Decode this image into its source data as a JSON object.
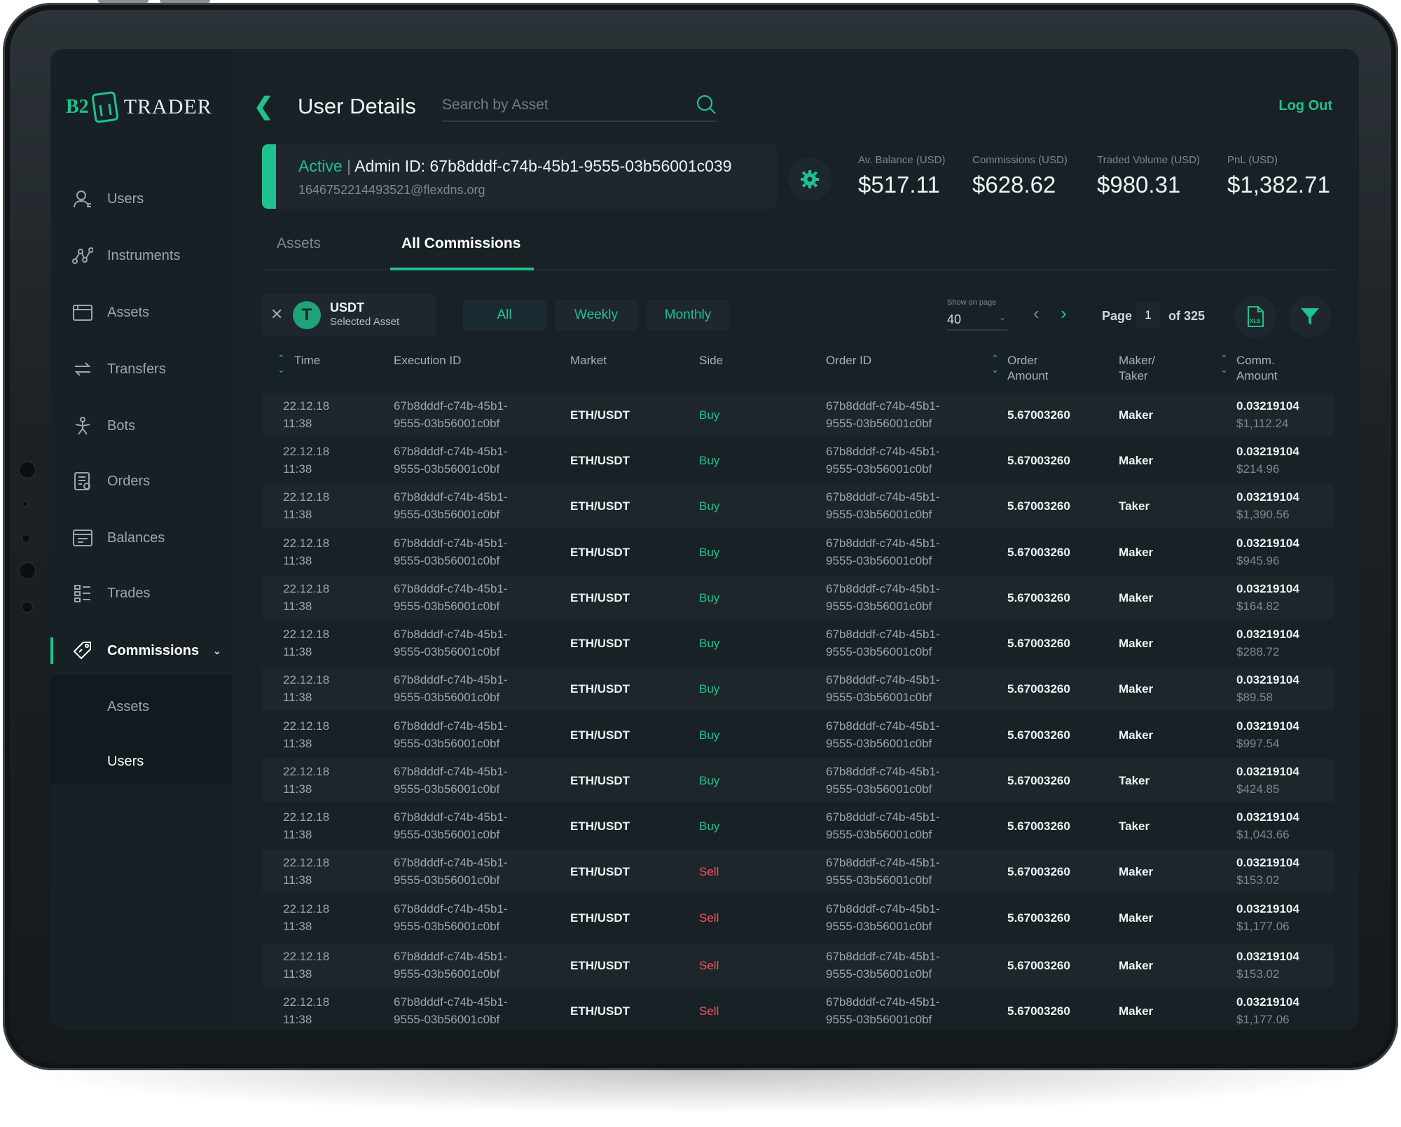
{
  "brand": {
    "left": "B2",
    "right": "TRADER"
  },
  "colors": {
    "accent": "#1fc28e",
    "sell": "#f0555c",
    "background": "#182126",
    "sidebar": "#162025"
  },
  "sidebar": {
    "items": [
      {
        "label": "Users",
        "icon": "user-icon"
      },
      {
        "label": "Instruments",
        "icon": "instruments-icon"
      },
      {
        "label": "Assets",
        "icon": "wallet-icon"
      },
      {
        "label": "Transfers",
        "icon": "transfer-icon"
      },
      {
        "label": "Bots",
        "icon": "bot-icon"
      },
      {
        "label": "Orders",
        "icon": "orders-icon"
      },
      {
        "label": "Balances",
        "icon": "balances-icon"
      },
      {
        "label": "Trades",
        "icon": "trades-icon"
      },
      {
        "label": "Commissions",
        "icon": "tag-icon",
        "active": true
      }
    ],
    "submenu": [
      {
        "label": "Assets"
      },
      {
        "label": "Users",
        "active": true
      }
    ]
  },
  "header": {
    "title": "User Details",
    "search_placeholder": "Search by Asset",
    "logout": "Log Out"
  },
  "admin": {
    "status": "Active",
    "separator": "|",
    "id_text": "Admin ID: 67b8dddf-c74b-45b1-9555-03b56001c039",
    "email": "1646752214493521@flexdns.org"
  },
  "stats": [
    {
      "label": "Av. Balance (USD)",
      "value": "$517.11"
    },
    {
      "label": "Commissions (USD)",
      "value": "$628.62"
    },
    {
      "label": "Traded Volume (USD)",
      "value": "$980.31"
    },
    {
      "label": "PnL (USD)",
      "value": "$1,382.71"
    }
  ],
  "tabs": [
    {
      "label": "Assets"
    },
    {
      "label": "All Commissions",
      "active": true
    }
  ],
  "filters": {
    "asset_name": "USDT",
    "asset_sub": "Selected Asset",
    "asset_symbol": "T",
    "periods": [
      "All",
      "Weekly",
      "Monthly"
    ],
    "active_period": "All"
  },
  "pagination": {
    "show_label": "Show on page",
    "per_page": "40",
    "page_word": "Page",
    "page": "1",
    "of_text": "of 325"
  },
  "table": {
    "headers": {
      "time": "Time",
      "execution_id": "Execution ID",
      "market": "Market",
      "side": "Side",
      "order_id": "Order ID",
      "order_amount_1": "Order",
      "order_amount_2": "Amount",
      "maker_taker_1": "Maker/",
      "maker_taker_2": "Taker",
      "comm_amount_1": "Comm.",
      "comm_amount_2": "Amount"
    },
    "rows": [
      {
        "date": "22.12.18",
        "time": "11:38",
        "exec1": "67b8dddf-c74b-45b1-",
        "exec2": "9555-03b56001c0bf",
        "market": "ETH/USDT",
        "side": "Buy",
        "order1": "67b8dddf-c74b-45b1-",
        "order2": "9555-03b56001c0bf",
        "amount": "5.67003260",
        "mt": "Maker",
        "comm": "0.03219104",
        "usd": "$1,112.24"
      },
      {
        "date": "22.12.18",
        "time": "11:38",
        "exec1": "67b8dddf-c74b-45b1-",
        "exec2": "9555-03b56001c0bf",
        "market": "ETH/USDT",
        "side": "Buy",
        "order1": "67b8dddf-c74b-45b1-",
        "order2": "9555-03b56001c0bf",
        "amount": "5.67003260",
        "mt": "Maker",
        "comm": "0.03219104",
        "usd": "$214.96"
      },
      {
        "date": "22.12.18",
        "time": "11:38",
        "exec1": "67b8dddf-c74b-45b1-",
        "exec2": "9555-03b56001c0bf",
        "market": "ETH/USDT",
        "side": "Buy",
        "order1": "67b8dddf-c74b-45b1-",
        "order2": "9555-03b56001c0bf",
        "amount": "5.67003260",
        "mt": "Taker",
        "comm": "0.03219104",
        "usd": "$1,390.56"
      },
      {
        "date": "22.12.18",
        "time": "11:38",
        "exec1": "67b8dddf-c74b-45b1-",
        "exec2": "9555-03b56001c0bf",
        "market": "ETH/USDT",
        "side": "Buy",
        "order1": "67b8dddf-c74b-45b1-",
        "order2": "9555-03b56001c0bf",
        "amount": "5.67003260",
        "mt": "Maker",
        "comm": "0.03219104",
        "usd": "$945.96"
      },
      {
        "date": "22.12.18",
        "time": "11:38",
        "exec1": "67b8dddf-c74b-45b1-",
        "exec2": "9555-03b56001c0bf",
        "market": "ETH/USDT",
        "side": "Buy",
        "order1": "67b8dddf-c74b-45b1-",
        "order2": "9555-03b56001c0bf",
        "amount": "5.67003260",
        "mt": "Maker",
        "comm": "0.03219104",
        "usd": "$164.82"
      },
      {
        "date": "22.12.18",
        "time": "11:38",
        "exec1": "67b8dddf-c74b-45b1-",
        "exec2": "9555-03b56001c0bf",
        "market": "ETH/USDT",
        "side": "Buy",
        "order1": "67b8dddf-c74b-45b1-",
        "order2": "9555-03b56001c0bf",
        "amount": "5.67003260",
        "mt": "Maker",
        "comm": "0.03219104",
        "usd": "$288.72"
      },
      {
        "date": "22.12.18",
        "time": "11:38",
        "exec1": "67b8dddf-c74b-45b1-",
        "exec2": "9555-03b56001c0bf",
        "market": "ETH/USDT",
        "side": "Buy",
        "order1": "67b8dddf-c74b-45b1-",
        "order2": "9555-03b56001c0bf",
        "amount": "5.67003260",
        "mt": "Maker",
        "comm": "0.03219104",
        "usd": "$89.58"
      },
      {
        "date": "22.12.18",
        "time": "11:38",
        "exec1": "67b8dddf-c74b-45b1-",
        "exec2": "9555-03b56001c0bf",
        "market": "ETH/USDT",
        "side": "Buy",
        "order1": "67b8dddf-c74b-45b1-",
        "order2": "9555-03b56001c0bf",
        "amount": "5.67003260",
        "mt": "Maker",
        "comm": "0.03219104",
        "usd": "$997.54"
      },
      {
        "date": "22.12.18",
        "time": "11:38",
        "exec1": "67b8dddf-c74b-45b1-",
        "exec2": "9555-03b56001c0bf",
        "market": "ETH/USDT",
        "side": "Buy",
        "order1": "67b8dddf-c74b-45b1-",
        "order2": "9555-03b56001c0bf",
        "amount": "5.67003260",
        "mt": "Taker",
        "comm": "0.03219104",
        "usd": "$424.85"
      },
      {
        "date": "22.12.18",
        "time": "11:38",
        "exec1": "67b8dddf-c74b-45b1-",
        "exec2": "9555-03b56001c0bf",
        "market": "ETH/USDT",
        "side": "Buy",
        "order1": "67b8dddf-c74b-45b1-",
        "order2": "9555-03b56001c0bf",
        "amount": "5.67003260",
        "mt": "Taker",
        "comm": "0.03219104",
        "usd": "$1,043.66"
      },
      {
        "date": "22.12.18",
        "time": "11:38",
        "exec1": "67b8dddf-c74b-45b1-",
        "exec2": "9555-03b56001c0bf",
        "market": "ETH/USDT",
        "side": "Sell",
        "order1": "67b8dddf-c74b-45b1-",
        "order2": "9555-03b56001c0bf",
        "amount": "5.67003260",
        "mt": "Maker",
        "comm": "0.03219104",
        "usd": "$153.02"
      },
      {
        "date": "22.12.18",
        "time": "11:38",
        "exec1": "67b8dddf-c74b-45b1-",
        "exec2": "9555-03b56001c0bf",
        "market": "ETH/USDT",
        "side": "Sell",
        "order1": "67b8dddf-c74b-45b1-",
        "order2": "9555-03b56001c0bf",
        "amount": "5.67003260",
        "mt": "Maker",
        "comm": "0.03219104",
        "usd": "$1,177.06"
      },
      {
        "date": "22.12.18",
        "time": "11:38",
        "exec1": "67b8dddf-c74b-45b1-",
        "exec2": "9555-03b56001c0bf",
        "market": "ETH/USDT",
        "side": "Sell",
        "order1": "67b8dddf-c74b-45b1-",
        "order2": "9555-03b56001c0bf",
        "amount": "5.67003260",
        "mt": "Maker",
        "comm": "0.03219104",
        "usd": "$153.02"
      },
      {
        "date": "22.12.18",
        "time": "11:38",
        "exec1": "67b8dddf-c74b-45b1-",
        "exec2": "9555-03b56001c0bf",
        "market": "ETH/USDT",
        "side": "Sell",
        "order1": "67b8dddf-c74b-45b1-",
        "order2": "9555-03b56001c0bf",
        "amount": "5.67003260",
        "mt": "Maker",
        "comm": "0.03219104",
        "usd": "$1,177.06"
      }
    ]
  }
}
